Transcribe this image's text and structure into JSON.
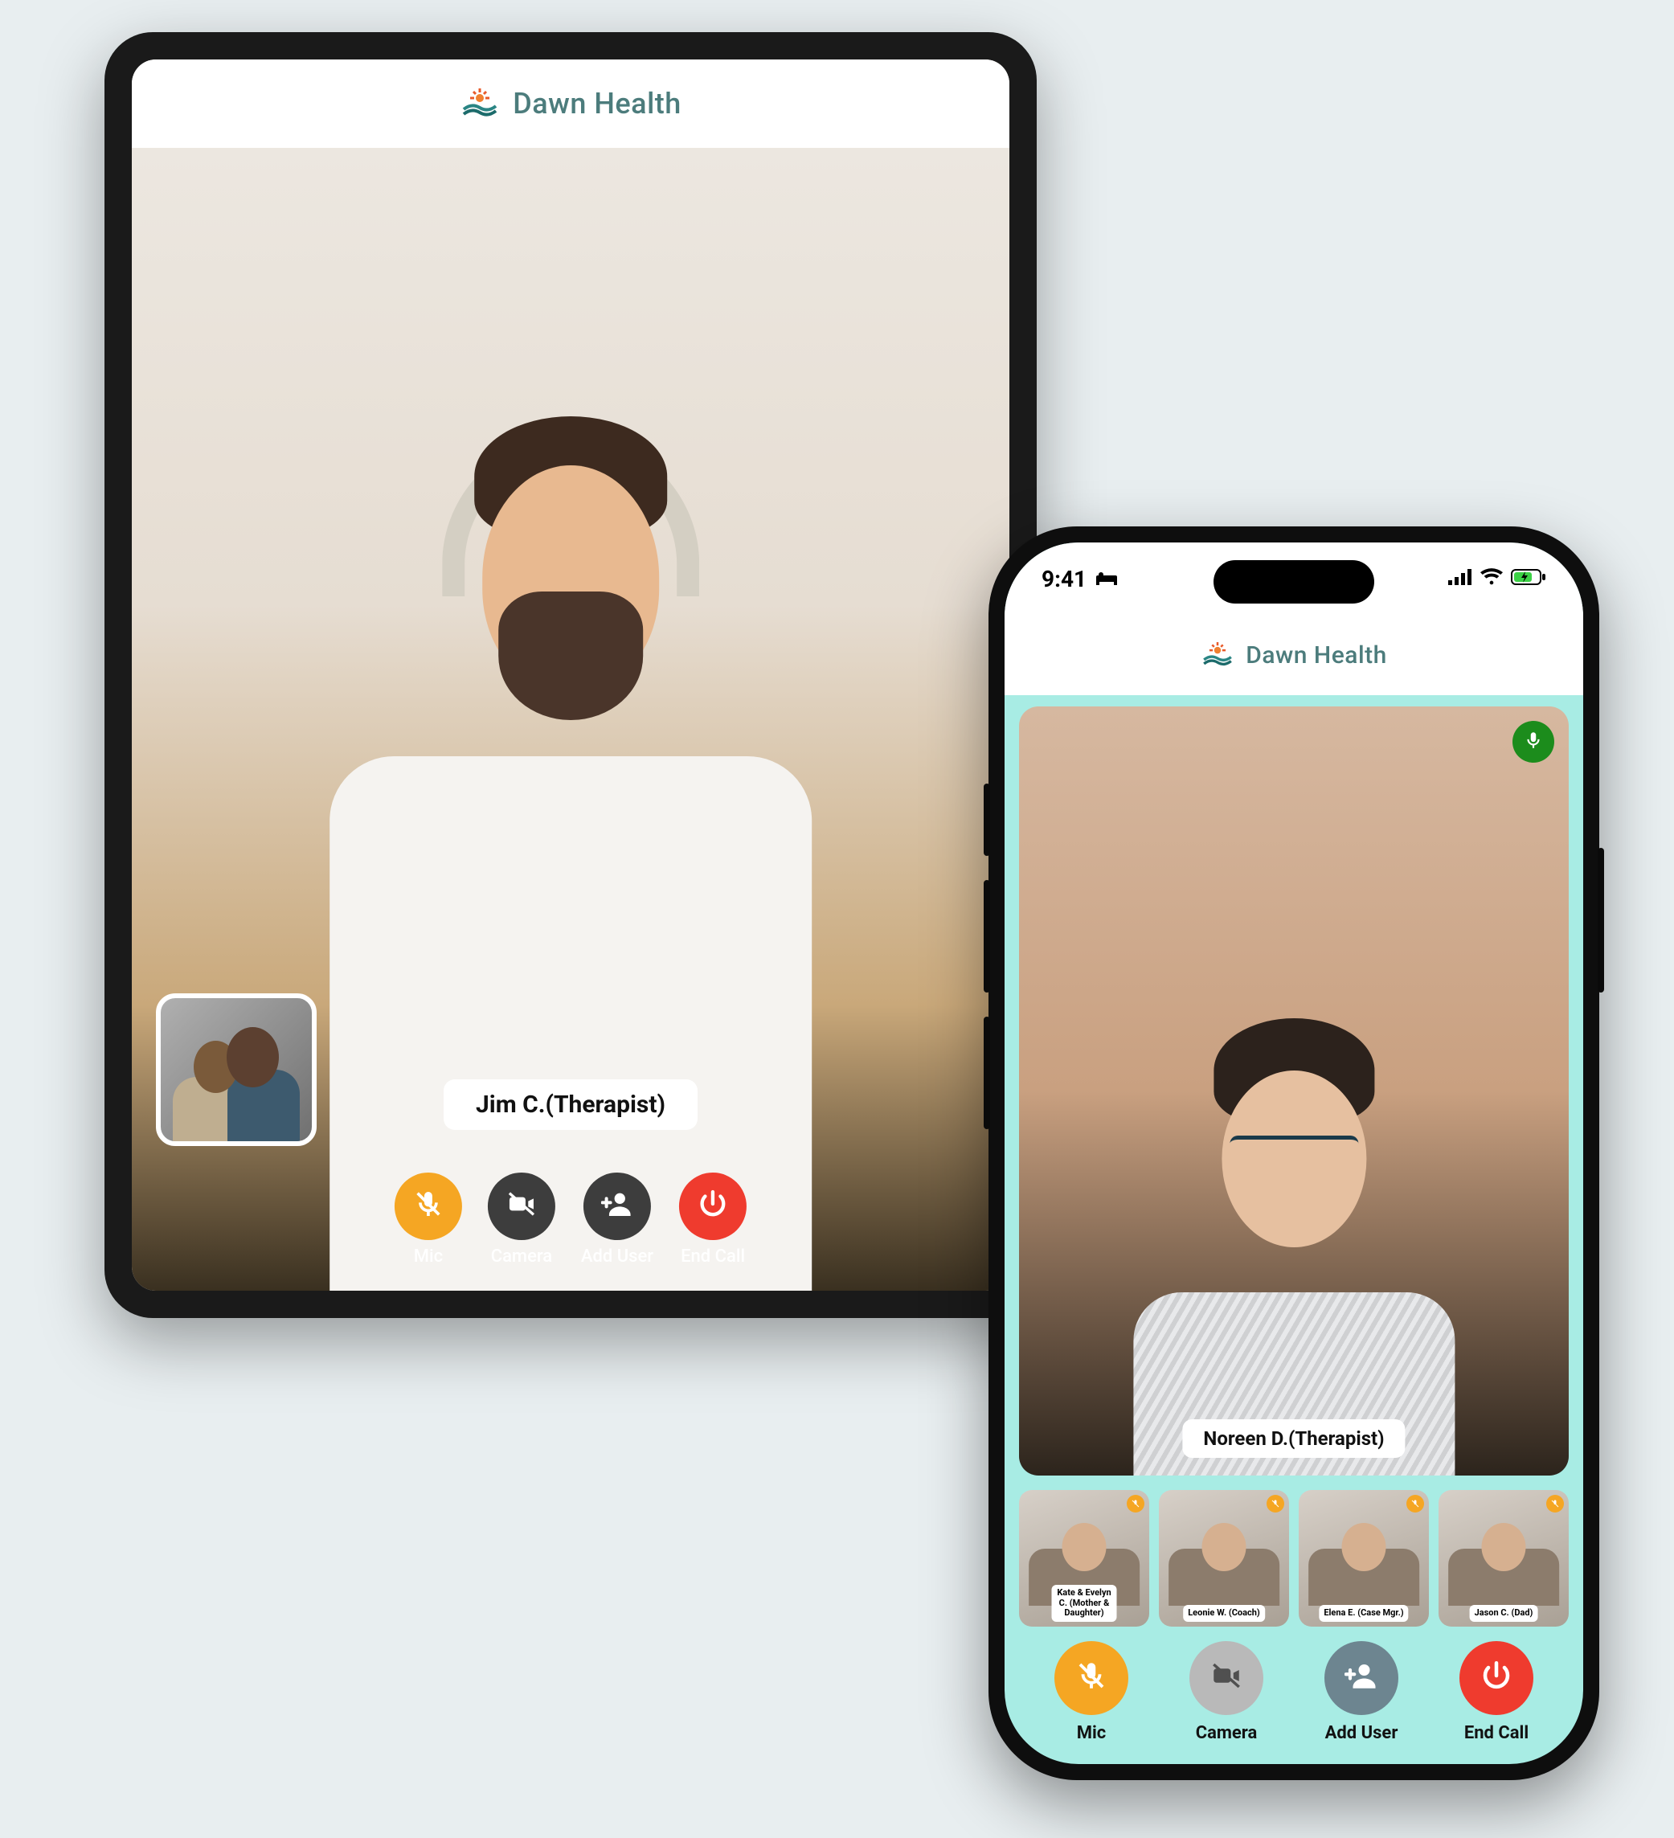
{
  "brand": {
    "name": "Dawn Health"
  },
  "tablet": {
    "main_participant_label": "Jim C.(Therapist)",
    "controls": {
      "mic": "Mic",
      "camera": "Camera",
      "add_user": "Add User",
      "end_call": "End Call"
    }
  },
  "phone": {
    "status_time": "9:41",
    "main_participant_label": "Noreen D.(Therapist)",
    "thumbnails": [
      {
        "label": "Kate & Evelyn C. (Mother & Daughter)"
      },
      {
        "label": "Leonie W. (Coach)"
      },
      {
        "label": "Elena E. (Case Mgr.)"
      },
      {
        "label": "Jason C. (Dad)"
      }
    ],
    "controls": {
      "mic": "Mic",
      "camera": "Camera",
      "add_user": "Add User",
      "end_call": "End Call"
    }
  },
  "icons": {
    "mic_muted": "mic-muted-icon",
    "mic": "mic-icon",
    "camera_off": "camera-off-icon",
    "add_user": "add-user-icon",
    "power": "power-icon"
  },
  "colors": {
    "accent_orange": "#f5a623",
    "accent_red": "#ef3b2e",
    "phone_bg": "#a8ece4",
    "brand_text": "#4c7c7c",
    "mic_active_green": "#1c8c1c"
  }
}
